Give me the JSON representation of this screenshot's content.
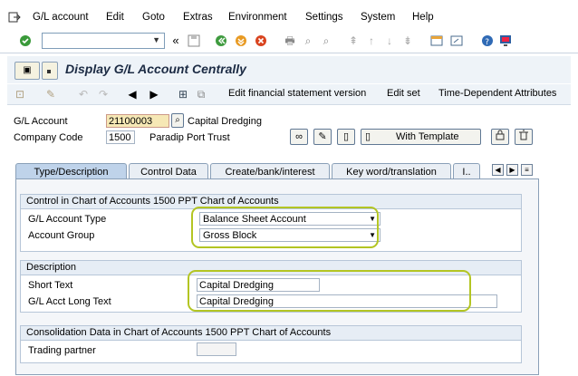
{
  "menu": {
    "items": [
      "G/L account",
      "Edit",
      "Goto",
      "Extras",
      "Environment",
      "Settings",
      "System",
      "Help"
    ]
  },
  "title": "Display G/L Account Centrally",
  "app_toolbar": {
    "edit_fs_version": "Edit financial statement version",
    "edit_set": "Edit set",
    "time_dependent": "Time-Dependent Attributes"
  },
  "header": {
    "gl_account_label": "G/L Account",
    "gl_account_value": "21100003",
    "gl_account_desc": "Capital Dredging",
    "company_code_label": "Company Code",
    "company_code_value": "1500",
    "company_name": "Paradip Port Trust",
    "with_template_label": "With Template"
  },
  "tabs": [
    "Type/Description",
    "Control Data",
    "Create/bank/interest",
    "Key word/translation",
    "I.."
  ],
  "control_group": {
    "title": "Control in Chart of Accounts 1500 PPT Chart of Accounts",
    "type_label": "G/L Account Type",
    "type_value": "Balance Sheet Account",
    "group_label": "Account Group",
    "group_value": "Gross Block"
  },
  "description_group": {
    "title": "Description",
    "short_label": "Short Text",
    "short_value": "Capital Dredging",
    "long_label": "G/L Acct Long Text",
    "long_value": "Capital Dredging"
  },
  "consolidation_group": {
    "title": "Consolidation Data in Chart of Accounts 1500 PPT Chart of Accounts",
    "partner_label": "Trading partner",
    "partner_value": ""
  },
  "colors": {
    "highlight": "#b3c523",
    "tab_active": "#bfd3ea",
    "title_text": "#1c2b44"
  }
}
